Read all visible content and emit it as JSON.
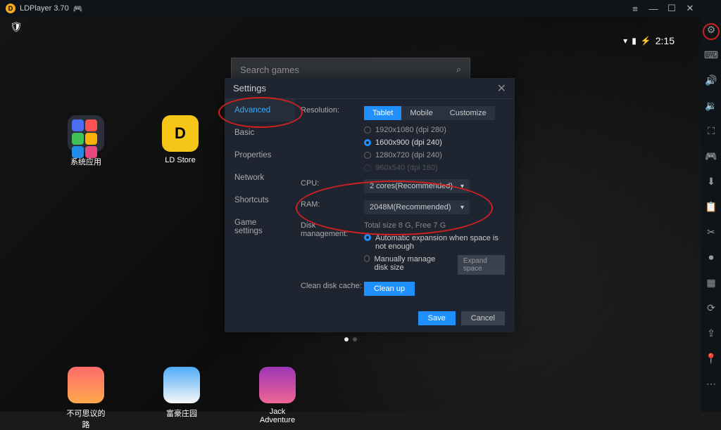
{
  "titlebar": {
    "appName": "LDPlayer",
    "version": "3.70"
  },
  "statusbar": {
    "time": "2:15"
  },
  "search": {
    "placeholder": "Search games"
  },
  "apps_top": [
    {
      "label": "系统应用"
    },
    {
      "label": "LD Store"
    }
  ],
  "apps_bottom": [
    {
      "label": "不可思议的路"
    },
    {
      "label": "富豪庄园"
    },
    {
      "label": "Jack Adventure"
    }
  ],
  "settings": {
    "title": "Settings",
    "nav": [
      "Advanced",
      "Basic",
      "Properties",
      "Network",
      "Shortcuts",
      "Game settings"
    ],
    "resolution": {
      "label": "Resolution:",
      "tabs": [
        "Tablet",
        "Mobile",
        "Customize"
      ],
      "options": [
        "1920x1080  (dpi 280)",
        "1600x900  (dpi 240)",
        "1280x720  (dpi 240)",
        "960x540  (dpi 160)"
      ]
    },
    "cpu": {
      "label": "CPU:",
      "value": "2 cores(Recommended)"
    },
    "ram": {
      "label": "RAM:",
      "value": "2048M(Recommended)"
    },
    "disk": {
      "label": "Disk management:",
      "total": "Total size 8 G,  Free 7 G",
      "opt1": "Automatic expansion when space is not enough",
      "opt2": "Manually manage disk size",
      "expand": "Expand space"
    },
    "cache": {
      "label": "Clean disk cache:",
      "btn": "Clean up"
    },
    "save": "Save",
    "cancel": "Cancel"
  }
}
